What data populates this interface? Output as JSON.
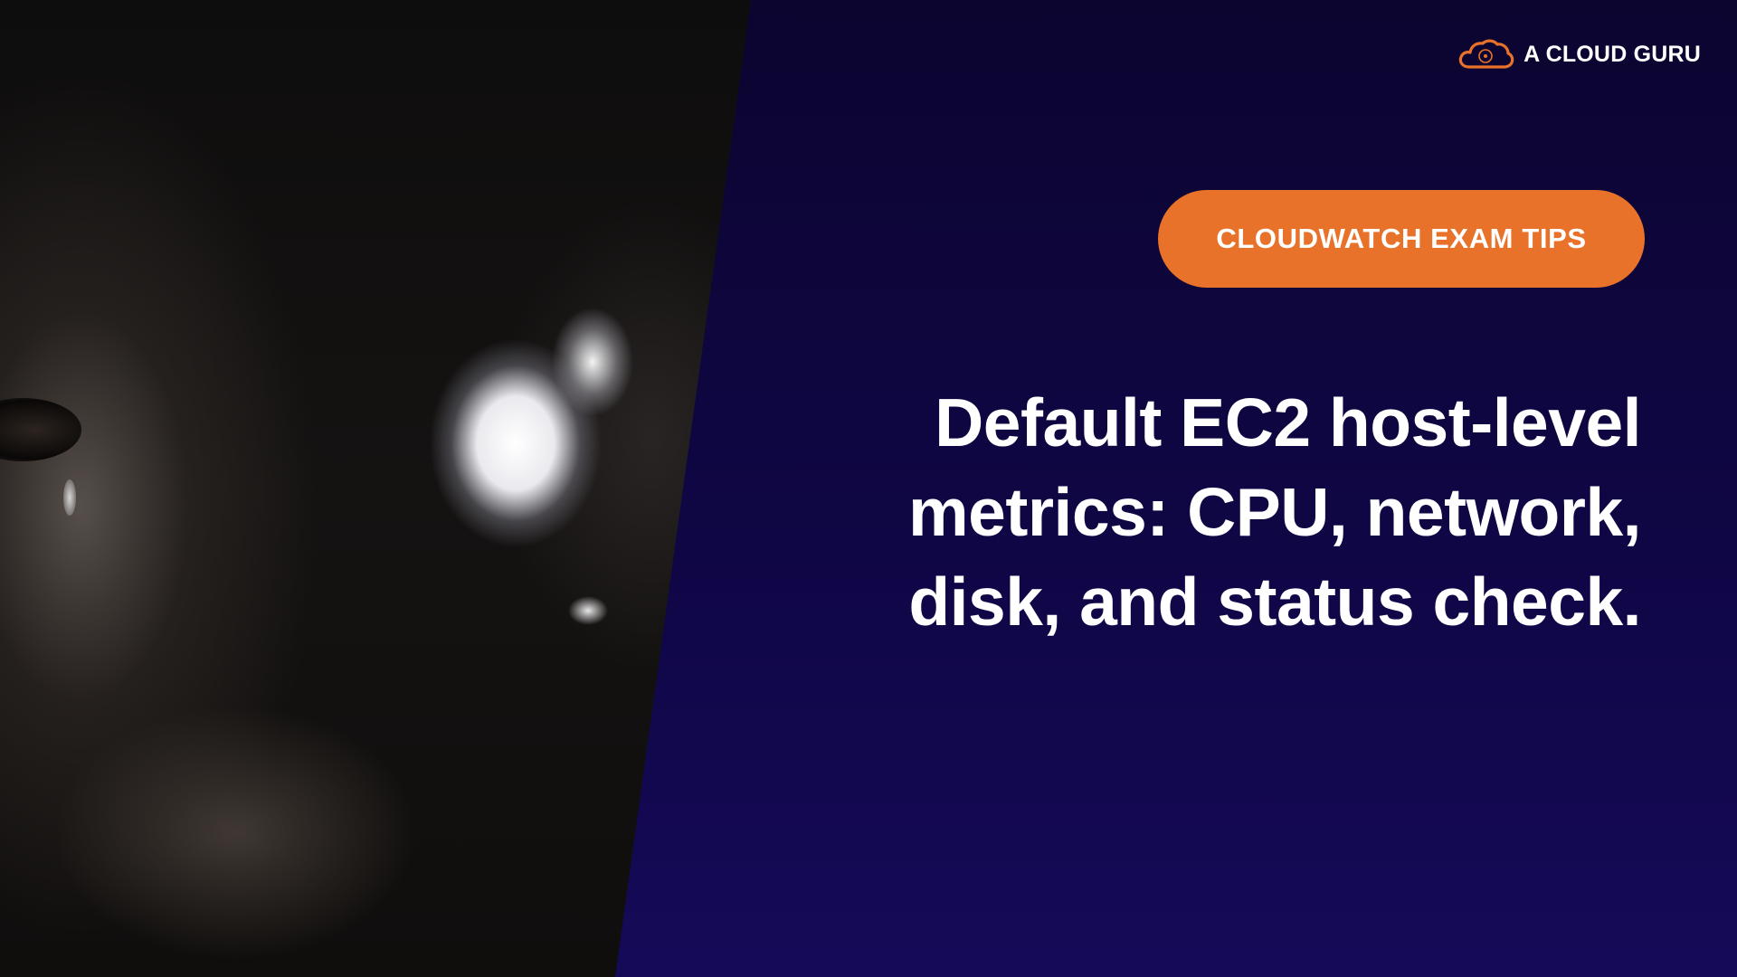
{
  "brand": {
    "name": "A CLOUD GURU",
    "logo_icon": "cloud-logo-icon",
    "accent_color": "#e8722a"
  },
  "badge": {
    "label": "CLOUDWATCH EXAM TIPS"
  },
  "headline": {
    "lines": [
      "Default EC2 host-level",
      "metrics: CPU, network,",
      "disk, and status check."
    ]
  },
  "colors": {
    "background": "#0f0645",
    "text": "#ffffff",
    "badge": "#e8722a"
  }
}
